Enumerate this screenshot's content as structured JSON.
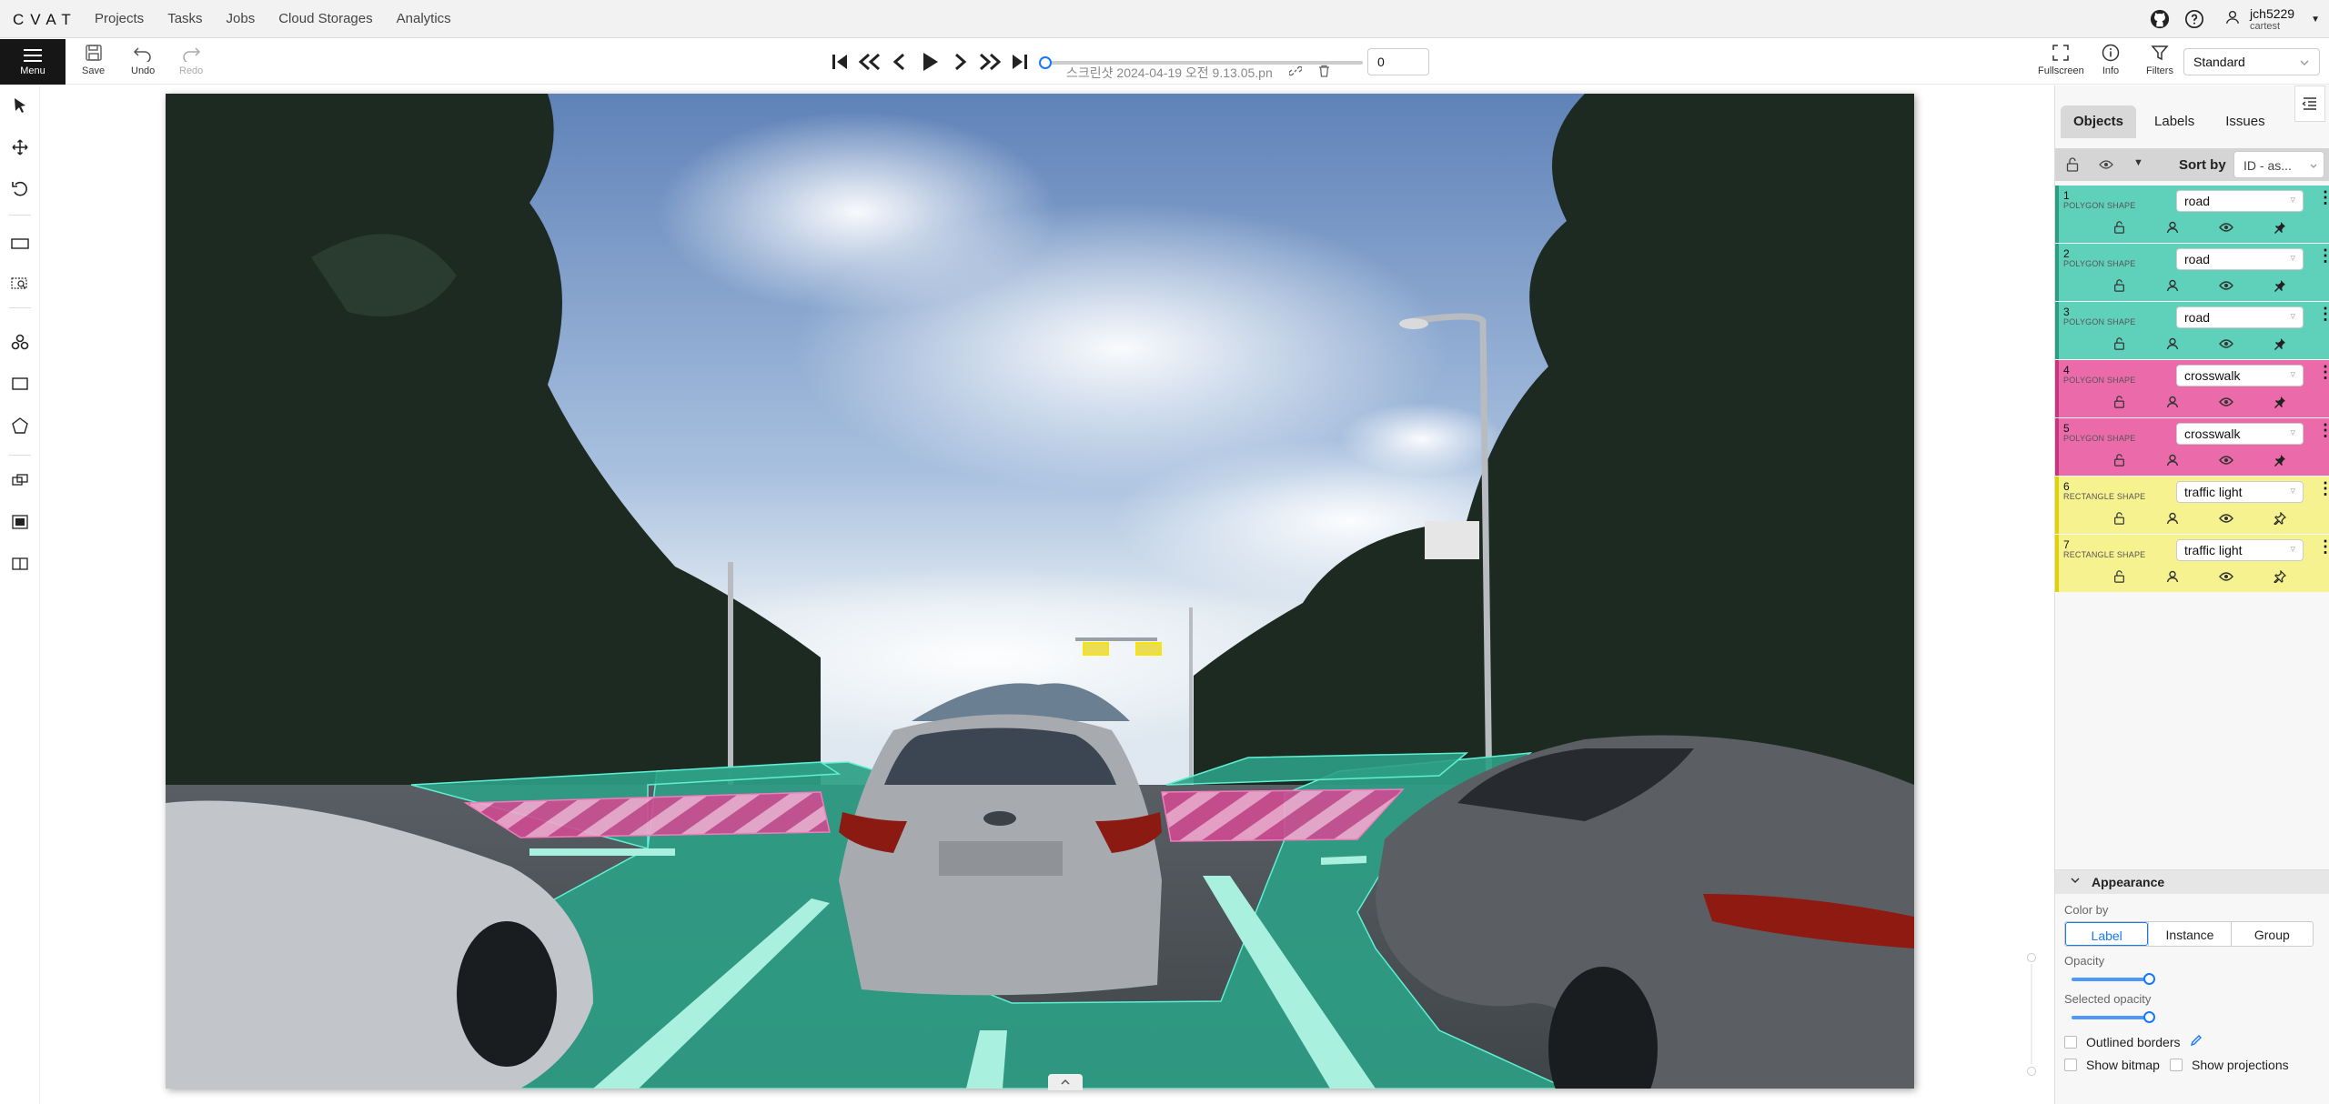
{
  "app": {
    "logo": "CVAT"
  },
  "nav": {
    "items": [
      "Projects",
      "Tasks",
      "Jobs",
      "Cloud Storages",
      "Analytics"
    ]
  },
  "user": {
    "name": "jch5229",
    "org": "cartest"
  },
  "toolbar": {
    "menu_label": "Menu",
    "save_label": "Save",
    "undo_label": "Undo",
    "redo_label": "Redo",
    "fullscreen_label": "Fullscreen",
    "info_label": "Info",
    "filters_label": "Filters",
    "view_mode": "Standard"
  },
  "player": {
    "filename": "스크린샷 2024-04-19 오전 9.13.05.pn",
    "frame": "0",
    "progress": 0
  },
  "sidebar": {
    "tabs": [
      "Objects",
      "Labels",
      "Issues"
    ],
    "sort_label": "Sort by",
    "sort_value": "ID - as...",
    "objects": [
      {
        "id": "1",
        "type": "POLYGON SHAPE",
        "label": "road",
        "color": "#3fc8ae",
        "pinned": true
      },
      {
        "id": "2",
        "type": "POLYGON SHAPE",
        "label": "road",
        "color": "#3fc8ae",
        "pinned": true
      },
      {
        "id": "3",
        "type": "POLYGON SHAPE",
        "label": "road",
        "color": "#3fc8ae",
        "pinned": true
      },
      {
        "id": "4",
        "type": "POLYGON SHAPE",
        "label": "crosswalk",
        "color": "#e8559e",
        "pinned": true
      },
      {
        "id": "5",
        "type": "POLYGON SHAPE",
        "label": "crosswalk",
        "color": "#e8559e",
        "pinned": true
      },
      {
        "id": "6",
        "type": "RECTANGLE SHAPE",
        "label": "traffic light",
        "color": "#f5f27a",
        "pinned": false
      },
      {
        "id": "7",
        "type": "RECTANGLE SHAPE",
        "label": "traffic light",
        "color": "#f5f27a",
        "pinned": false
      }
    ]
  },
  "appearance": {
    "title": "Appearance",
    "color_by_label": "Color by",
    "color_by_options": [
      "Label",
      "Instance",
      "Group"
    ],
    "color_by_selected": "Label",
    "opacity_label": "Opacity",
    "selected_opacity_label": "Selected opacity",
    "outlined_borders_label": "Outlined borders",
    "show_bitmap_label": "Show bitmap",
    "show_projections_label": "Show projections"
  },
  "colors": {
    "road": "#2a9d82",
    "crosswalk": "#d9559e",
    "traffic_light": "#f5e50a",
    "accent": "#1677ff"
  }
}
